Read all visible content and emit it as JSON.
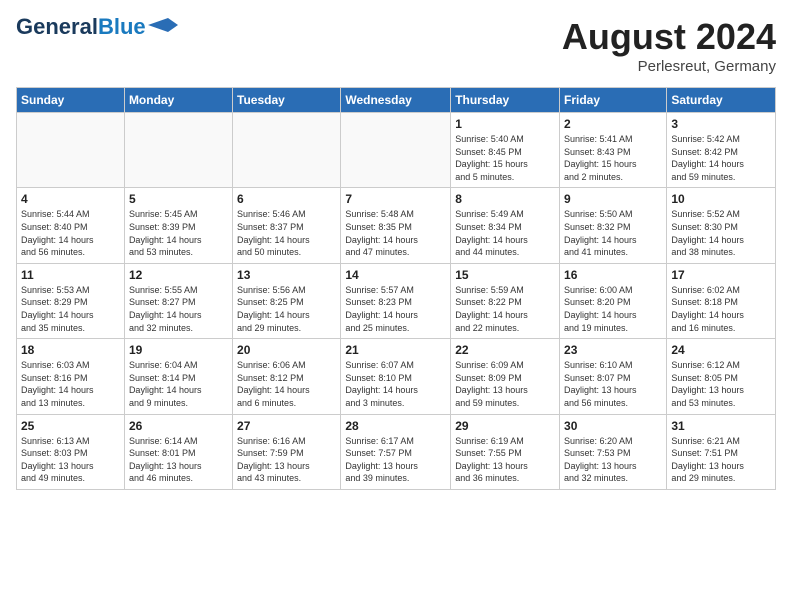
{
  "header": {
    "logo_line1": "General",
    "logo_line2": "Blue",
    "month_year": "August 2024",
    "location": "Perlesreut, Germany"
  },
  "days_of_week": [
    "Sunday",
    "Monday",
    "Tuesday",
    "Wednesday",
    "Thursday",
    "Friday",
    "Saturday"
  ],
  "weeks": [
    [
      {
        "day": "",
        "info": ""
      },
      {
        "day": "",
        "info": ""
      },
      {
        "day": "",
        "info": ""
      },
      {
        "day": "",
        "info": ""
      },
      {
        "day": "1",
        "info": "Sunrise: 5:40 AM\nSunset: 8:45 PM\nDaylight: 15 hours\nand 5 minutes."
      },
      {
        "day": "2",
        "info": "Sunrise: 5:41 AM\nSunset: 8:43 PM\nDaylight: 15 hours\nand 2 minutes."
      },
      {
        "day": "3",
        "info": "Sunrise: 5:42 AM\nSunset: 8:42 PM\nDaylight: 14 hours\nand 59 minutes."
      }
    ],
    [
      {
        "day": "4",
        "info": "Sunrise: 5:44 AM\nSunset: 8:40 PM\nDaylight: 14 hours\nand 56 minutes."
      },
      {
        "day": "5",
        "info": "Sunrise: 5:45 AM\nSunset: 8:39 PM\nDaylight: 14 hours\nand 53 minutes."
      },
      {
        "day": "6",
        "info": "Sunrise: 5:46 AM\nSunset: 8:37 PM\nDaylight: 14 hours\nand 50 minutes."
      },
      {
        "day": "7",
        "info": "Sunrise: 5:48 AM\nSunset: 8:35 PM\nDaylight: 14 hours\nand 47 minutes."
      },
      {
        "day": "8",
        "info": "Sunrise: 5:49 AM\nSunset: 8:34 PM\nDaylight: 14 hours\nand 44 minutes."
      },
      {
        "day": "9",
        "info": "Sunrise: 5:50 AM\nSunset: 8:32 PM\nDaylight: 14 hours\nand 41 minutes."
      },
      {
        "day": "10",
        "info": "Sunrise: 5:52 AM\nSunset: 8:30 PM\nDaylight: 14 hours\nand 38 minutes."
      }
    ],
    [
      {
        "day": "11",
        "info": "Sunrise: 5:53 AM\nSunset: 8:29 PM\nDaylight: 14 hours\nand 35 minutes."
      },
      {
        "day": "12",
        "info": "Sunrise: 5:55 AM\nSunset: 8:27 PM\nDaylight: 14 hours\nand 32 minutes."
      },
      {
        "day": "13",
        "info": "Sunrise: 5:56 AM\nSunset: 8:25 PM\nDaylight: 14 hours\nand 29 minutes."
      },
      {
        "day": "14",
        "info": "Sunrise: 5:57 AM\nSunset: 8:23 PM\nDaylight: 14 hours\nand 25 minutes."
      },
      {
        "day": "15",
        "info": "Sunrise: 5:59 AM\nSunset: 8:22 PM\nDaylight: 14 hours\nand 22 minutes."
      },
      {
        "day": "16",
        "info": "Sunrise: 6:00 AM\nSunset: 8:20 PM\nDaylight: 14 hours\nand 19 minutes."
      },
      {
        "day": "17",
        "info": "Sunrise: 6:02 AM\nSunset: 8:18 PM\nDaylight: 14 hours\nand 16 minutes."
      }
    ],
    [
      {
        "day": "18",
        "info": "Sunrise: 6:03 AM\nSunset: 8:16 PM\nDaylight: 14 hours\nand 13 minutes."
      },
      {
        "day": "19",
        "info": "Sunrise: 6:04 AM\nSunset: 8:14 PM\nDaylight: 14 hours\nand 9 minutes."
      },
      {
        "day": "20",
        "info": "Sunrise: 6:06 AM\nSunset: 8:12 PM\nDaylight: 14 hours\nand 6 minutes."
      },
      {
        "day": "21",
        "info": "Sunrise: 6:07 AM\nSunset: 8:10 PM\nDaylight: 14 hours\nand 3 minutes."
      },
      {
        "day": "22",
        "info": "Sunrise: 6:09 AM\nSunset: 8:09 PM\nDaylight: 13 hours\nand 59 minutes."
      },
      {
        "day": "23",
        "info": "Sunrise: 6:10 AM\nSunset: 8:07 PM\nDaylight: 13 hours\nand 56 minutes."
      },
      {
        "day": "24",
        "info": "Sunrise: 6:12 AM\nSunset: 8:05 PM\nDaylight: 13 hours\nand 53 minutes."
      }
    ],
    [
      {
        "day": "25",
        "info": "Sunrise: 6:13 AM\nSunset: 8:03 PM\nDaylight: 13 hours\nand 49 minutes."
      },
      {
        "day": "26",
        "info": "Sunrise: 6:14 AM\nSunset: 8:01 PM\nDaylight: 13 hours\nand 46 minutes."
      },
      {
        "day": "27",
        "info": "Sunrise: 6:16 AM\nSunset: 7:59 PM\nDaylight: 13 hours\nand 43 minutes."
      },
      {
        "day": "28",
        "info": "Sunrise: 6:17 AM\nSunset: 7:57 PM\nDaylight: 13 hours\nand 39 minutes."
      },
      {
        "day": "29",
        "info": "Sunrise: 6:19 AM\nSunset: 7:55 PM\nDaylight: 13 hours\nand 36 minutes."
      },
      {
        "day": "30",
        "info": "Sunrise: 6:20 AM\nSunset: 7:53 PM\nDaylight: 13 hours\nand 32 minutes."
      },
      {
        "day": "31",
        "info": "Sunrise: 6:21 AM\nSunset: 7:51 PM\nDaylight: 13 hours\nand 29 minutes."
      }
    ]
  ]
}
